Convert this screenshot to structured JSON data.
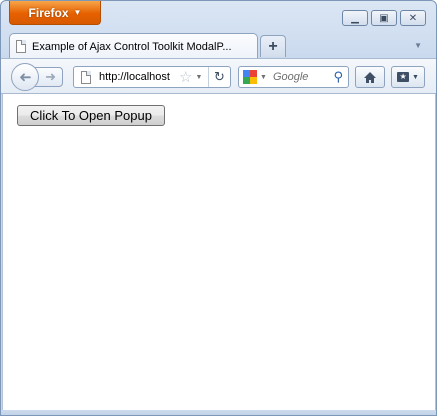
{
  "window": {
    "app_button_label": "Firefox",
    "controls": [
      "minimize",
      "restore",
      "close"
    ]
  },
  "tabs": [
    {
      "title": "Example of Ajax Control Toolkit ModalP...",
      "active": true
    }
  ],
  "toolbar": {
    "url": "http://localhost",
    "search_placeholder": "Google"
  },
  "page": {
    "button_label": "Click To Open Popup"
  },
  "colors": {
    "firefox_orange": "#e66000",
    "chrome_blue": "#c9d9ee"
  }
}
